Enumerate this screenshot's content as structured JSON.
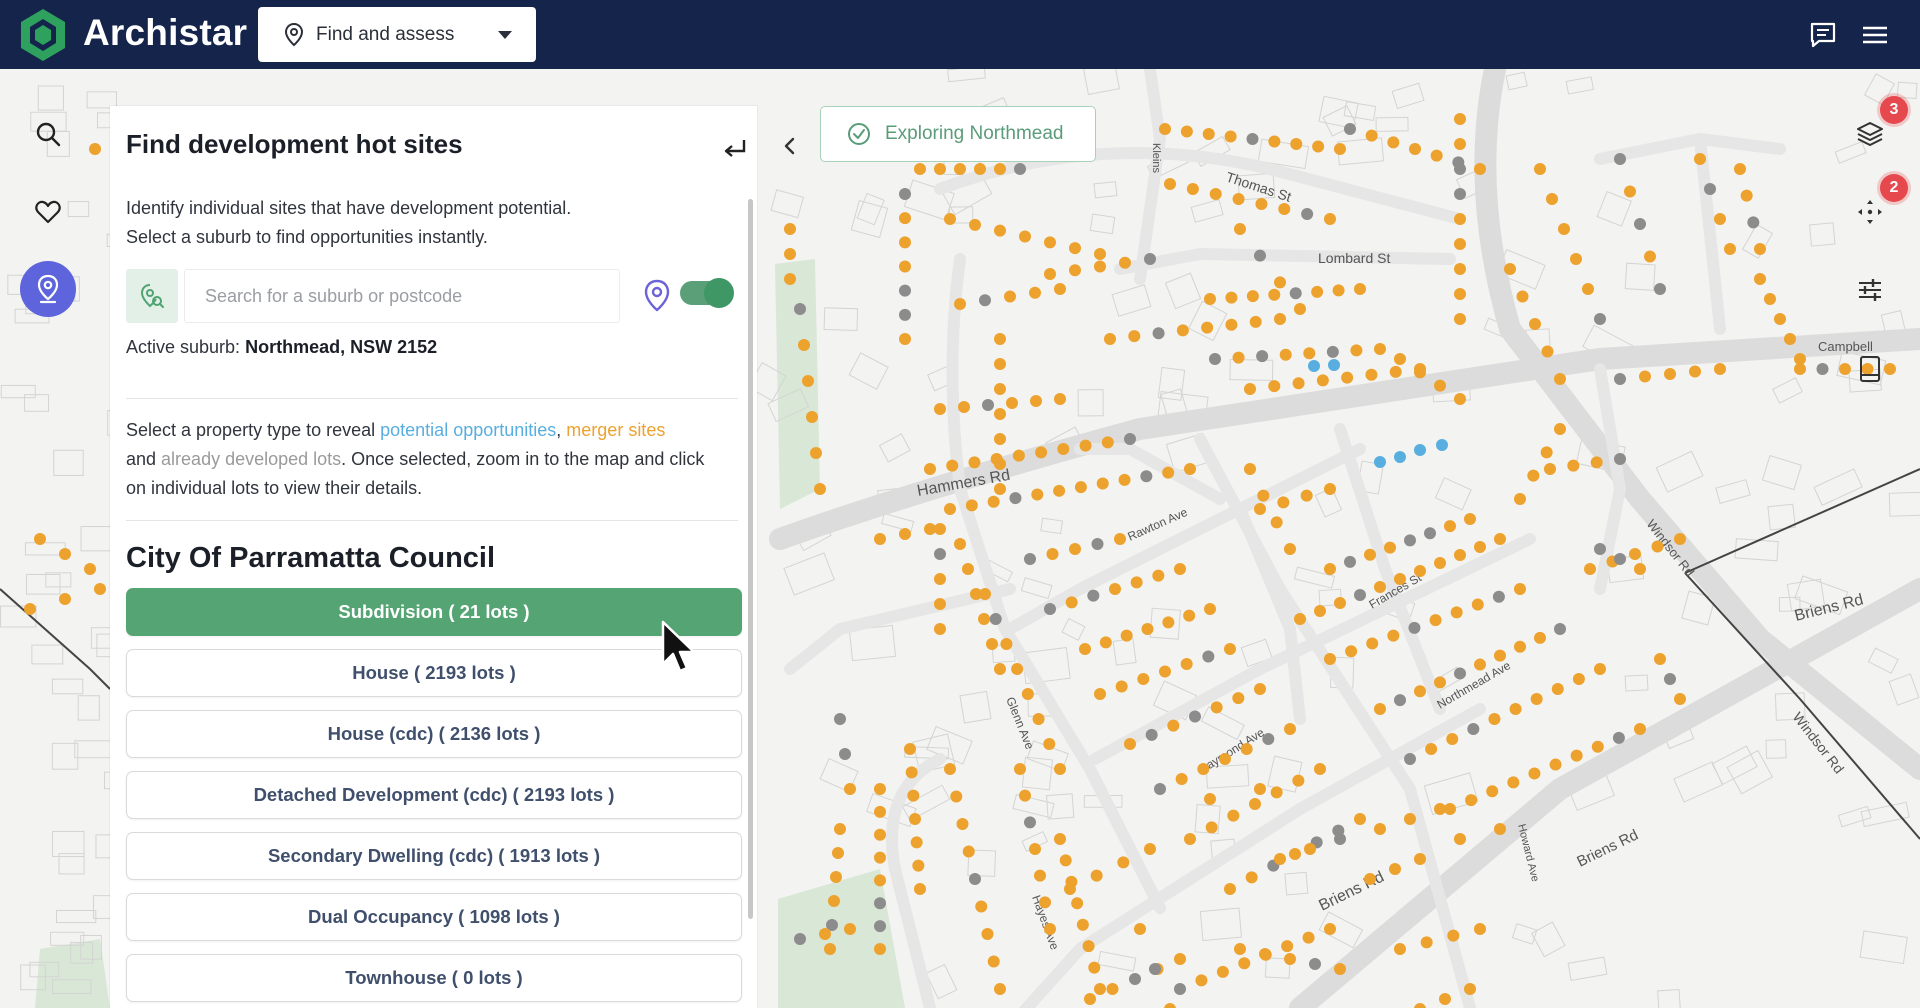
{
  "app": {
    "name": "Archistar"
  },
  "header": {
    "mode_label": "Find and assess",
    "icons": [
      "location-pin-icon",
      "caret-down-icon",
      "chat-icon",
      "hamburger-menu-icon"
    ]
  },
  "rail": {
    "items": [
      {
        "icon": "search-icon"
      },
      {
        "icon": "heart-icon"
      },
      {
        "icon": "location-target-icon",
        "active": true
      }
    ]
  },
  "panel": {
    "title": "Find development hot sites",
    "desc_line1": "Identify individual sites that have development potential.",
    "desc_line2": "Select a suburb to find opportunities instantly.",
    "search_placeholder": "Search for a suburb or postcode",
    "active_label": "Active suburb:",
    "active_value": "Northmead, NSW 2152",
    "instr_1": "Select a property type to reveal ",
    "instr_link1": "potential opportunities",
    "instr_comma": ",",
    "instr_link2": "merger sites",
    "instr_2": "and ",
    "instr_link3": "already developed lots",
    "instr_3": ". Once selected, zoom in to the map and click on individual lots to view their details.",
    "council": "City Of Parramatta Council",
    "property_types": [
      {
        "label": "Subdivision ( 21 lots )",
        "selected": true
      },
      {
        "label": "House ( 2193 lots )"
      },
      {
        "label": "House (cdc) ( 2136 lots )"
      },
      {
        "label": "Detached Development (cdc) ( 2193 lots )"
      },
      {
        "label": "Secondary Dwelling (cdc) ( 1913 lots )"
      },
      {
        "label": "Dual Occupancy ( 1098 lots )"
      },
      {
        "label": "Townhouse ( 0 lots )"
      }
    ],
    "toggle_on": true
  },
  "map": {
    "exploring_label": "Exploring Northmead",
    "street_labels": [
      "Thomas St",
      "Lombard St",
      "Hammers Rd",
      "Rawton Ave",
      "Frances St",
      "Windsor Rd",
      "Briens Rd",
      "Northmead Ave",
      "Raymond Ave",
      "Glenn Ave",
      "Hayes Ave",
      "Howard Ave",
      "Campbell",
      "Kleins"
    ],
    "colors": {
      "potential": "#59aee0",
      "merger": "#eda22e",
      "developed": "#8c8c8c"
    }
  },
  "right_tools": [
    {
      "icon": "layers-icon",
      "badge": "3"
    },
    {
      "icon": "move-icon",
      "badge": "2"
    },
    {
      "icon": "sliders-icon"
    },
    {
      "icon": "tablet-icon"
    }
  ],
  "colors": {
    "header_bg": "#14244a",
    "accent_green": "#55a574",
    "active_purple": "#5d64dc"
  }
}
